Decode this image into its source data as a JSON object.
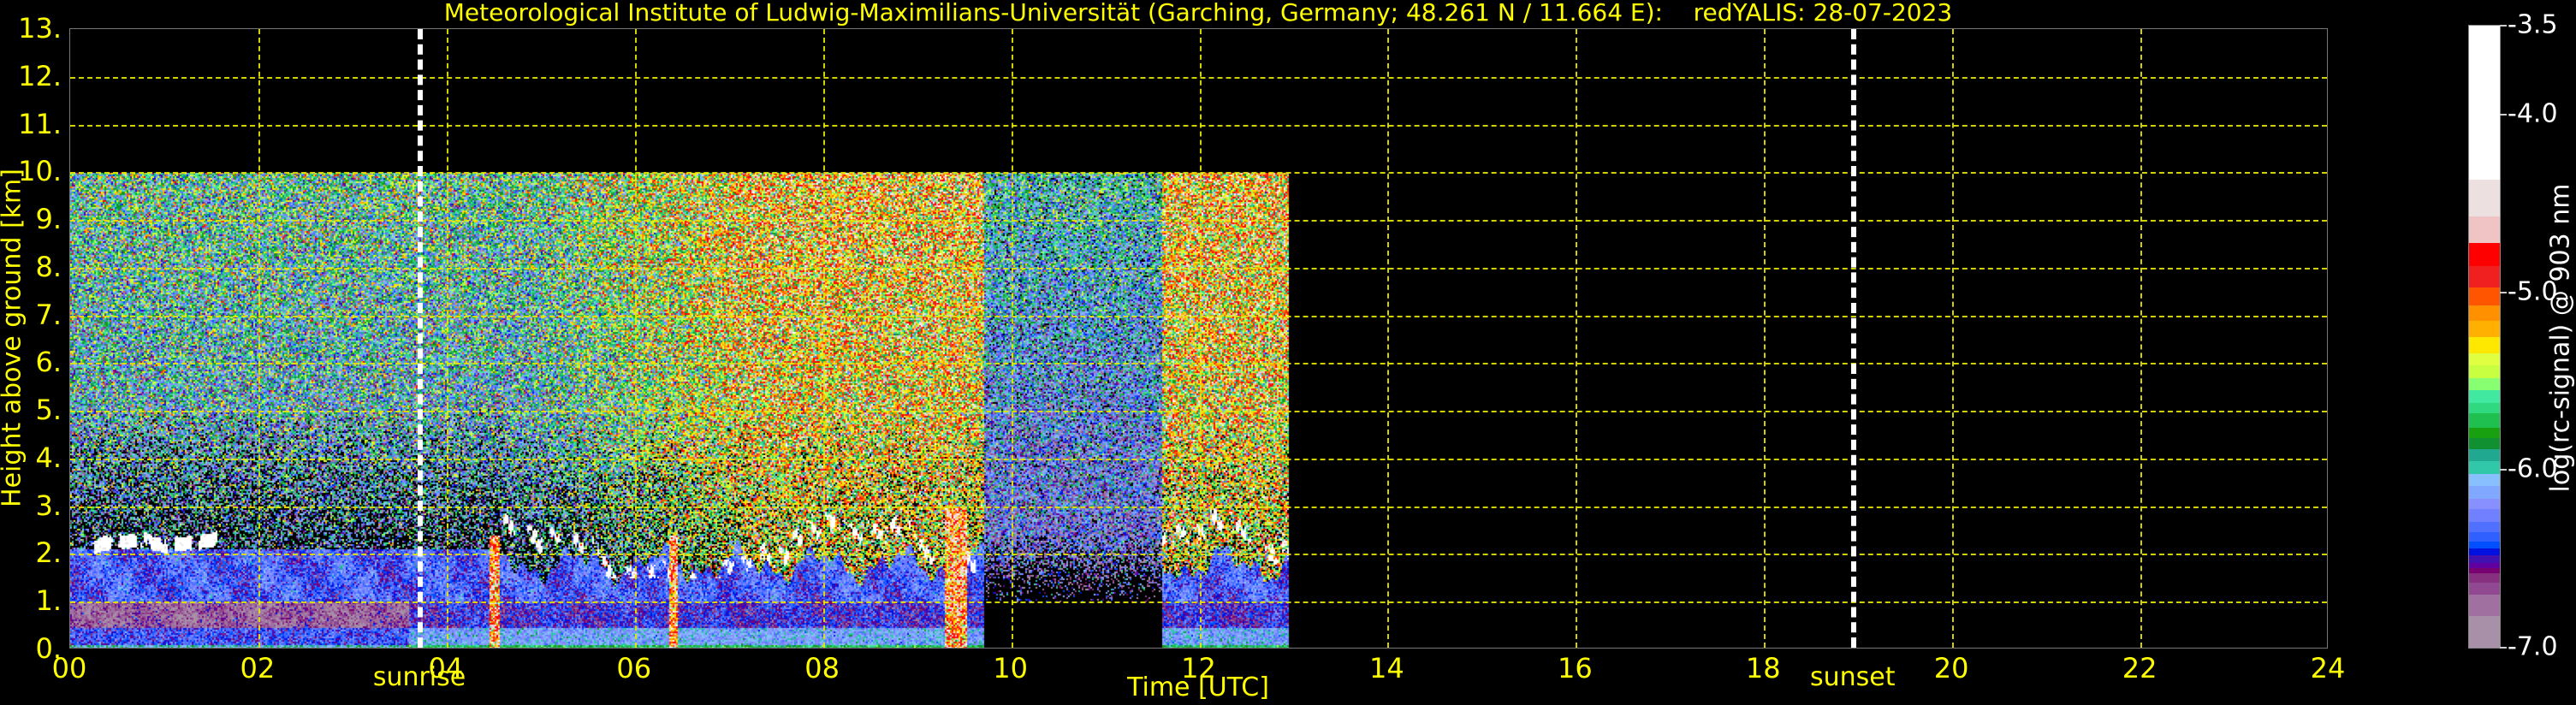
{
  "chart_data": {
    "type": "heatmap",
    "title": "Meteorological Institute of Ludwig-Maximilians-Universität (Garching, Germany; 48.261 N / 11.664 E):    redYALIS: 28-07-2023",
    "xlabel": "Time [UTC]",
    "ylabel": "Height above ground [km]",
    "xlim": [
      0,
      24
    ],
    "ylim": [
      0,
      13
    ],
    "xticks": [
      0,
      2,
      4,
      6,
      8,
      10,
      12,
      14,
      16,
      18,
      20,
      22,
      24
    ],
    "xtick_labels": [
      "00",
      "02",
      "04",
      "06",
      "08",
      "10",
      "12",
      "14",
      "16",
      "18",
      "20",
      "22",
      "24"
    ],
    "yticks": [
      0,
      1,
      2,
      3,
      4,
      5,
      6,
      7,
      8,
      9,
      10,
      11,
      12,
      13
    ],
    "ytick_labels": [
      "0.",
      "1.",
      "2.",
      "3.",
      "4.",
      "5.",
      "6.",
      "7.",
      "8.",
      "9.",
      "10.",
      "11.",
      "12.",
      "13."
    ],
    "grid": true,
    "data_coverage": {
      "max_height_km": 10,
      "segments": [
        {
          "start_h": 0.0,
          "end_h": 9.7,
          "mode": "full"
        },
        {
          "start_h": 9.7,
          "end_h": 11.6,
          "mode": "weak-above-1km"
        },
        {
          "start_h": 11.6,
          "end_h": 12.95,
          "mode": "full"
        }
      ]
    },
    "features": {
      "boundary_layer_top_km": {
        "night": 2.1,
        "day": 2.8
      },
      "night_cloud_layer": {
        "start_h": 0.2,
        "end_h": 1.6,
        "height_km": 2.25
      },
      "day_cumulus": {
        "start_h": 4.6,
        "end_h": 12.95,
        "base_km": [
          1.5,
          3.0
        ]
      },
      "precip_columns_h": [
        4.5,
        6.4,
        9.4
      ]
    },
    "annotations": [
      {
        "label": "sunrise",
        "time_h": 3.72
      },
      {
        "label": "sunset",
        "time_h": 18.95
      }
    ],
    "colorbar": {
      "label": "log(rc-signal) @ 903 nm",
      "range": [
        -7.0,
        -3.5
      ],
      "ticks": [
        -3.5,
        -4.0,
        -5.0,
        -6.0,
        -7.0
      ],
      "tick_labels": [
        "-3.5",
        "-4.0",
        "-5.0",
        "-6.0",
        "-7.0"
      ],
      "bounds": [
        -7.0,
        -6.82,
        -6.7,
        -6.63,
        -6.58,
        -6.55,
        -6.52,
        -6.48,
        -6.44,
        -6.4,
        -6.35,
        -6.29,
        -6.22,
        -6.16,
        -6.09,
        -6.02,
        -5.95,
        -5.88,
        -5.82,
        -5.76,
        -5.68,
        -5.62,
        -5.55,
        -5.48,
        -5.41,
        -5.34,
        -5.25,
        -5.16,
        -5.07,
        -4.97,
        -4.85,
        -4.72,
        -4.57,
        -4.365,
        -3.5
      ],
      "colors": [
        "#a890a8",
        "#a070a0",
        "#904890",
        "#883080",
        "#780070",
        "#6000a0",
        "#4010b0",
        "#0010e0",
        "#0050ff",
        "#3060ff",
        "#5070ff",
        "#7080ff",
        "#8890ff",
        "#80a8ff",
        "#88c0ff",
        "#30c8a8",
        "#20a890",
        "#109030",
        "#18a010",
        "#20c050",
        "#30d880",
        "#40e8a0",
        "#88ff70",
        "#c8ff40",
        "#e0ff40",
        "#ffe800",
        "#ffb000",
        "#ff9000",
        "#ff5500",
        "#f02020",
        "#ff0000",
        "#f0c4c4",
        "#ece0e0",
        "#ffffff"
      ]
    }
  }
}
